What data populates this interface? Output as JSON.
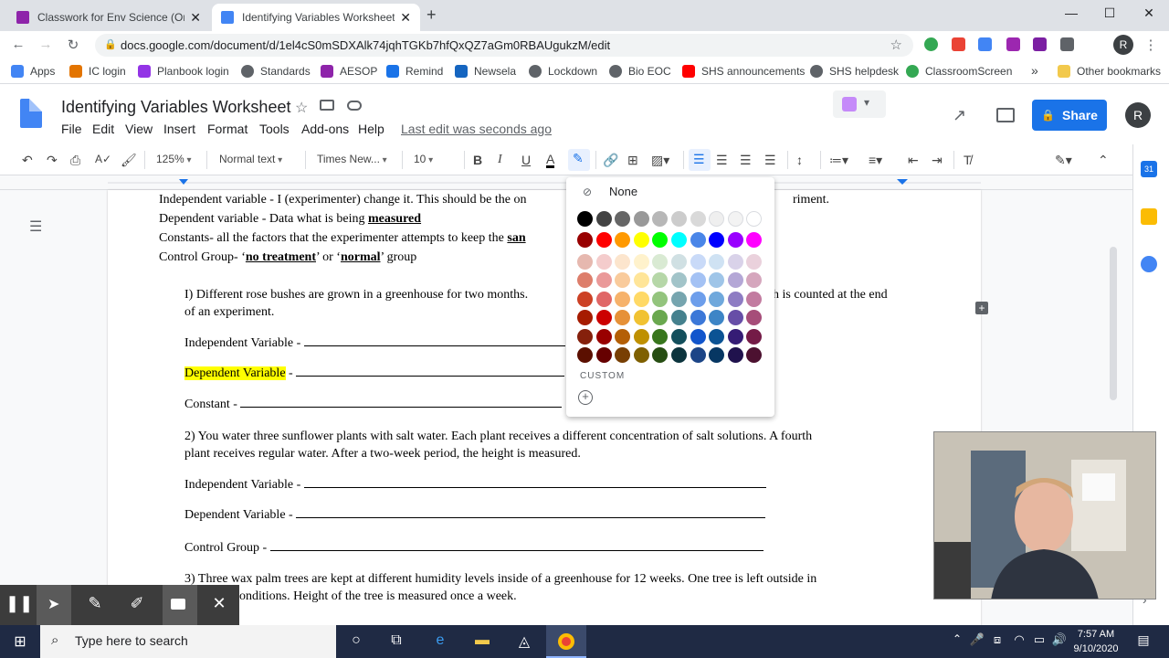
{
  "browser": {
    "tabs": [
      {
        "title": "Classwork for Env Science (Onlin",
        "active": false
      },
      {
        "title": "Identifying Variables Worksheet -",
        "active": true
      }
    ],
    "new_tab": "+",
    "window_controls": {
      "minimize": "—",
      "maximize": "☐",
      "close": "✕"
    },
    "url": "docs.google.com/document/d/1el4cS0mSDXAlk74jqhTGKb7hfQxQZ7aGm0RBAUgukzM/edit",
    "profile_initial": "R",
    "bookmarks": [
      {
        "label": "Apps",
        "color": "#4285f4"
      },
      {
        "label": "IC login",
        "color": "#e37400"
      },
      {
        "label": "Planbook login",
        "color": "#9334e6"
      },
      {
        "label": "Standards",
        "color": "#5f6368"
      },
      {
        "label": "AESOP",
        "color": "#8e24aa"
      },
      {
        "label": "Remind",
        "color": "#1a73e8"
      },
      {
        "label": "Newsela",
        "color": "#1565c0"
      },
      {
        "label": "Lockdown",
        "color": "#5f6368"
      },
      {
        "label": "Bio EOC",
        "color": "#5f6368"
      },
      {
        "label": "SHS announcements",
        "color": "#ff0000"
      },
      {
        "label": "SHS helpdesk",
        "color": "#5f6368"
      },
      {
        "label": "ClassroomScreen",
        "color": "#34a853"
      }
    ],
    "bookmarks_overflow": "»",
    "other_bookmarks": "Other bookmarks"
  },
  "docs": {
    "title": "Identifying Variables Worksheet",
    "menus": [
      "File",
      "Edit",
      "View",
      "Insert",
      "Format",
      "Tools",
      "Add-ons",
      "Help"
    ],
    "last_edit": "Last edit was seconds ago",
    "share_label": "Share",
    "avatar_initial": "R",
    "toolbar": {
      "zoom": "125%",
      "style": "Normal text",
      "font": "Times New...",
      "size": "10"
    }
  },
  "document": {
    "intro": [
      {
        "text": "Independent variable - I (experimenter) change it. This should be the on"
      },
      {
        "text": "Dependent variable - Data what is being ",
        "bold": "measured"
      },
      {
        "text": "Constants- all the factors that the experimenter attempts to keep the ",
        "bold": "san"
      },
      {
        "pre": "Control Group- ‘",
        "bold1": "no treatment",
        "mid": "’ or ‘",
        "bold2": "normal",
        "post": "’ group"
      }
    ],
    "intro_tail": "riment.",
    "q1": {
      "line1": "I) Different rose bushes are grown in a greenhouse for two months.",
      "line1_tail": "h is counted at the end",
      "line2": "of an experiment.",
      "fields": [
        "Independent Variable - ",
        "Dependent Variable",
        "Constant - "
      ],
      "dash": " -"
    },
    "q2": {
      "line1": "2) You water three sunflower plants with salt water. Each plant receives a different concentration of salt solutions. A fourth",
      "line2": "plant receives regular water. After a two-week period, the height is measured.",
      "fields": [
        "Independent Variable - ",
        "Dependent Variable - ",
        "Control Group - "
      ]
    },
    "q3": {
      "line1": "3) Three wax palm trees are kept at different humidity levels inside of a greenhouse for 12 weeks. One tree is left outside in",
      "line2": "onditions. Height of the tree is measured once a week."
    }
  },
  "color_picker": {
    "none_label": "None",
    "custom_label": "CUSTOM",
    "grays": [
      "#000000",
      "#434343",
      "#666666",
      "#999999",
      "#b7b7b7",
      "#cccccc",
      "#d9d9d9",
      "#efefef",
      "#f3f3f3",
      "#ffffff"
    ],
    "brights": [
      "#980000",
      "#ff0000",
      "#ff9900",
      "#ffff00",
      "#00ff00",
      "#00ffff",
      "#4a86e8",
      "#0000ff",
      "#9900ff",
      "#ff00ff"
    ],
    "shades": [
      [
        "#e6b8af",
        "#f4cccc",
        "#fce5cd",
        "#fff2cc",
        "#d9ead3",
        "#d0e0e3",
        "#c9daf8",
        "#cfe2f3",
        "#d9d2e9",
        "#ead1dc"
      ],
      [
        "#dd7e6b",
        "#ea9999",
        "#f9cb9c",
        "#ffe599",
        "#b6d7a8",
        "#a2c4c9",
        "#a4c2f4",
        "#9fc5e8",
        "#b4a7d6",
        "#d5a6bd"
      ],
      [
        "#cc4125",
        "#e06666",
        "#f6b26b",
        "#ffd966",
        "#93c47d",
        "#76a5af",
        "#6d9eeb",
        "#6fa8dc",
        "#8e7cc3",
        "#c27ba0"
      ],
      [
        "#a61c00",
        "#cc0000",
        "#e69138",
        "#f1c232",
        "#6aa84f",
        "#45818e",
        "#3c78d8",
        "#3d85c6",
        "#674ea7",
        "#a64d79"
      ],
      [
        "#85200c",
        "#990000",
        "#b45f06",
        "#bf9000",
        "#38761d",
        "#134f5c",
        "#1155cc",
        "#0b5394",
        "#351c75",
        "#741b47"
      ],
      [
        "#5b0f00",
        "#660000",
        "#783f04",
        "#7f6000",
        "#274e13",
        "#0c343d",
        "#1c4587",
        "#073763",
        "#20124d",
        "#4c1130"
      ]
    ]
  },
  "taskbar": {
    "search_placeholder": "Type here to search",
    "time": "7:57 AM",
    "date": "9/10/2020"
  }
}
